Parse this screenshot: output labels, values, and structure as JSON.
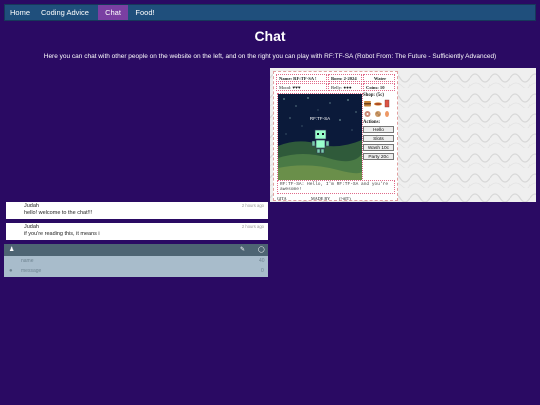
{
  "nav": {
    "items": [
      {
        "label": "Home",
        "active": false
      },
      {
        "label": "Coding Advice",
        "active": false
      },
      {
        "label": "Chat",
        "active": true
      },
      {
        "label": "Food!",
        "active": false
      }
    ]
  },
  "page": {
    "title": "Chat",
    "subtitle": "Here you can chat with other people on the website on the left, and on the right you can play with RF:TF-SA (Robot From: The Future - Sufficiently Advanced)"
  },
  "chat": {
    "messages": [
      {
        "author": "Judah",
        "time": "2 hours ago",
        "text": "hello! welcome to the chat!!!"
      },
      {
        "author": "Judah",
        "time": "2 hours ago",
        "text": "if you're reading this, it means i"
      }
    ],
    "name_placeholder": "name",
    "message_placeholder": "message",
    "name_counter": "40",
    "message_counter": "0"
  },
  "pet": {
    "name_label": "Name: RF:TF-SA !",
    "born_label": "Born: 2-2024",
    "water_label": "Water",
    "mood_label": "Mood: ♥♥♥",
    "belly_label": "Belly: ●●●",
    "coins_label": "Coins: 10",
    "shop_label": "Shop: (5c)",
    "actions_label": "Actions:",
    "screen_label": "RF:TF-SA",
    "buttons": [
      "Hello",
      "Slots",
      "Wash 10c",
      "Party 20c"
    ],
    "speech": "RF:TF-SA: Hello, I'm RF:TF-SA and you're awesome!",
    "footer": {
      "left": "GITA",
      "middle": "MADE BY",
      "right": "(!-#IT)"
    }
  },
  "colors": {
    "background": "#2a0a63",
    "nav": "#1f4f7c",
    "nav_active": "#7a3fa2",
    "chat_input": "#a8bccb",
    "chat_bar": "#4d6473"
  }
}
